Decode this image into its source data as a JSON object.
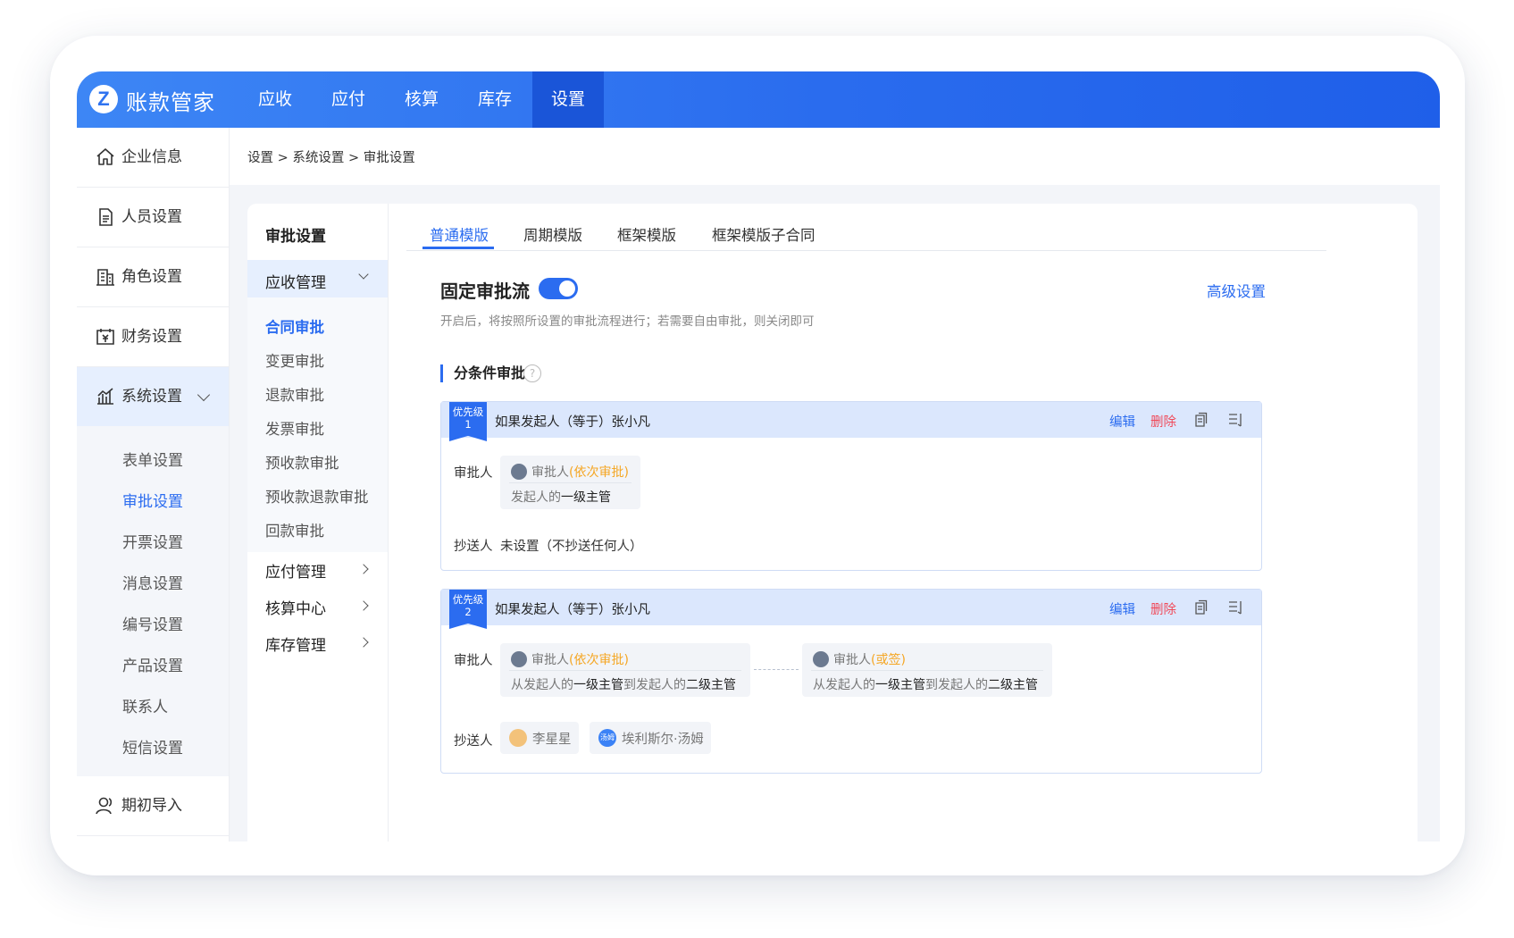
{
  "header": {
    "logo_letter": "Z",
    "brand": "账款管家",
    "nav": [
      "应收",
      "应付",
      "核算",
      "库存",
      "设置"
    ],
    "active_nav": "设置"
  },
  "sidebar": {
    "items": [
      {
        "label": "企业信息",
        "icon": "home-icon"
      },
      {
        "label": "人员设置",
        "icon": "document-icon"
      },
      {
        "label": "角色设置",
        "icon": "building-icon"
      },
      {
        "label": "财务设置",
        "icon": "finance-calendar-icon"
      },
      {
        "label": "系统设置",
        "icon": "chart-icon"
      },
      {
        "label": "期初导入",
        "icon": "user-icon"
      }
    ],
    "system_sub": [
      "表单设置",
      "审批设置",
      "开票设置",
      "消息设置",
      "编号设置",
      "产品设置",
      "联系人",
      "短信设置"
    ],
    "active_sub": "审批设置"
  },
  "breadcrumb": {
    "a": "设置",
    "sep1": ">",
    "b": "系统设置",
    "sep2": ">",
    "c": "审批设置"
  },
  "mid": {
    "title": "审批设置",
    "group": "应收管理",
    "items": [
      "合同审批",
      "变更审批",
      "退款审批",
      "发票审批",
      "预收款审批",
      "预收款退款审批",
      "回款审批"
    ],
    "active_item": "合同审批",
    "collapsed": [
      "应付管理",
      "核算中心",
      "库存管理"
    ]
  },
  "tabs": [
    "普通模版",
    "周期模版",
    "框架模版",
    "框架模版子合同"
  ],
  "active_tab": "普通模版",
  "flow": {
    "title": "固定审批流",
    "toggle_on": true,
    "advanced": "高级设置",
    "desc": "开启后，将按照所设置的审批流程进行；若需要自由审批，则关闭即可",
    "cond_title": "分条件审批",
    "help": "?"
  },
  "cards": [
    {
      "priority_label": "优先级",
      "priority_num": "1",
      "condition": "如果发起人（等于）张小凡",
      "edit": "编辑",
      "delete": "删除",
      "approver_label": "审批人",
      "approvers": [
        {
          "role": "审批人",
          "mode": "(依次审批)",
          "pre": "发起人的",
          "who": "一级主管",
          "mid": "",
          "who2": ""
        }
      ],
      "cc_label": "抄送人",
      "cc_text": "未设置（不抄送任何人）"
    },
    {
      "priority_label": "优先级",
      "priority_num": "2",
      "condition": "如果发起人（等于）张小凡",
      "edit": "编辑",
      "delete": "删除",
      "approver_label": "审批人",
      "approvers": [
        {
          "role": "审批人",
          "mode": "(依次审批)",
          "pre": "从发起人的",
          "who": "一级主管",
          "mid": "到发起人的",
          "who2": "二级主管"
        },
        {
          "role": "审批人",
          "mode": "(或签)",
          "pre": "从发起人的",
          "who": "一级主管",
          "mid": "到发起人的",
          "who2": "二级主管"
        }
      ],
      "cc_label": "抄送人",
      "cc_people": [
        {
          "name": "李星星",
          "avatar": "photo-avatar"
        },
        {
          "name": "埃利斯尔·汤姆",
          "avatar_text": "汤姆"
        }
      ]
    }
  ],
  "colors": {
    "primary": "#2b6cf0",
    "danger": "#f04a5a",
    "warning": "#f5a623",
    "header_active": "#1a55d8"
  }
}
